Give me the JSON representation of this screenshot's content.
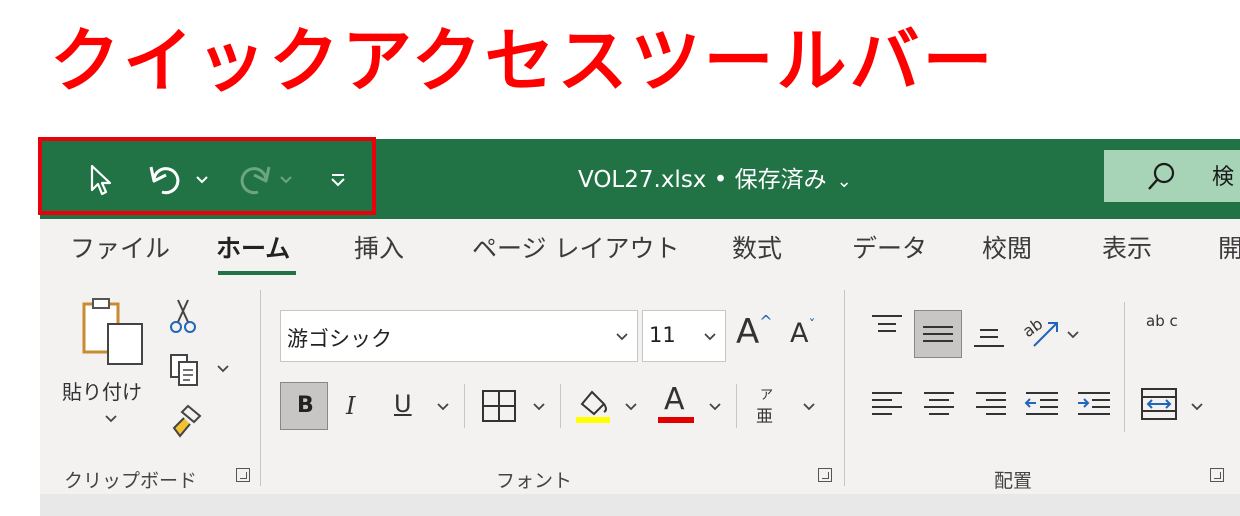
{
  "headline": "クイックアクセスツールバー",
  "titlebar": {
    "document_title": "VOL27.xlsx • 保存済み",
    "title_chevron": "⌄",
    "search_text": "検"
  },
  "tabs": [
    "ファイル",
    "ホーム",
    "挿入",
    "ページ レイアウト",
    "数式",
    "データ",
    "校閲",
    "表示",
    "開"
  ],
  "active_tab": "ホーム",
  "clipboard": {
    "paste_label": "貼り付け",
    "group_label": "クリップボード"
  },
  "font": {
    "font_name": "游ゴシック",
    "font_size": "11",
    "group_label": "フォント",
    "bold": "B",
    "italic": "I",
    "underline": "U",
    "font_color_letter": "A",
    "phonetic_top": "ア",
    "phonetic_bottom": "亜",
    "grow": "A",
    "shrink": "A"
  },
  "alignment": {
    "group_label": "配置",
    "wrap_text": "ab c"
  },
  "colors": {
    "titlebar": "#217346",
    "qat_highlight": "#e8000b",
    "headline": "#ff0000",
    "highlight_yellow": "#ffff00",
    "font_red": "#e00000"
  },
  "icons": [
    "select-cursor-icon",
    "undo-icon",
    "redo-icon",
    "customize-qat-icon",
    "search-icon",
    "paste-icon",
    "cut-icon",
    "copy-icon",
    "format-painter-icon",
    "borders-icon",
    "fill-color-icon",
    "align-top-icon",
    "align-middle-icon",
    "align-bottom-icon",
    "orientation-icon",
    "align-left-icon",
    "align-center-icon",
    "align-right-icon",
    "decrease-indent-icon",
    "increase-indent-icon",
    "merge-center-icon"
  ]
}
